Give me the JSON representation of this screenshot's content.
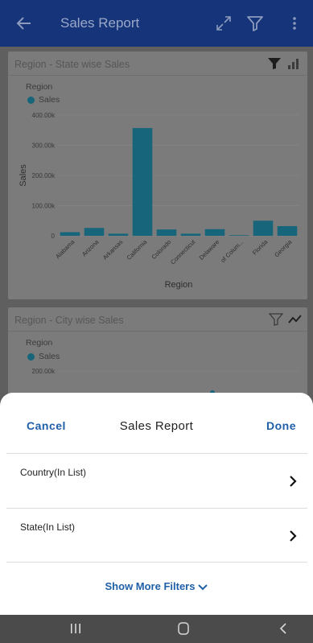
{
  "appbar": {
    "title": "Sales Report",
    "icons": [
      "back-arrow-icon",
      "expand-icon",
      "filter-icon",
      "more-vert-icon"
    ]
  },
  "card1": {
    "title": "Region - State wise Sales",
    "icons": [
      "filter-filled-icon",
      "bar-chart-icon"
    ]
  },
  "card2": {
    "title": "Region - City wise Sales",
    "icons": [
      "filter-outline-icon",
      "line-chart-icon"
    ],
    "legend_title": "Region",
    "legend_label": "Sales",
    "y_tick_visible": "200.00k"
  },
  "chart_data": [
    {
      "type": "bar",
      "title": "Region - State wise Sales",
      "legend_title": "Region",
      "legend_position": "top-left",
      "categories": [
        "Alabama",
        "Arizona",
        "Arkansas",
        "California",
        "Colorado",
        "Connecticut",
        "Delaware",
        "District of Columbia",
        "Florida",
        "Georgia"
      ],
      "tick_labels": [
        "Alabama",
        "Arizona",
        "Arkansas",
        "California",
        "Colorado",
        "Connecticut",
        "Delaware",
        "of Colum...",
        "Florida",
        "Georgia"
      ],
      "series": [
        {
          "name": "Sales",
          "color": "#17657a",
          "values": [
            12000,
            26000,
            7000,
            357000,
            21000,
            7000,
            22000,
            2000,
            50000,
            32000
          ]
        }
      ],
      "xlabel": "Region",
      "ylabel": "Sales",
      "ylim": [
        0,
        400000
      ],
      "yticks": [
        0,
        100000,
        200000,
        300000,
        400000
      ],
      "ytick_labels": [
        "0",
        "100.00k",
        "200.00k",
        "300.00k",
        "400.00k"
      ],
      "grid": true
    }
  ],
  "sheet": {
    "cancel_label": "Cancel",
    "title": "Sales Report",
    "done_label": "Done",
    "rows": [
      {
        "label": "Country(In List)"
      },
      {
        "label": "State(In List)"
      }
    ],
    "show_more_label": "Show More Filters"
  },
  "colors": {
    "appbar": "#16347a",
    "accent": "#1f5fa8",
    "bar": "#17657a"
  }
}
